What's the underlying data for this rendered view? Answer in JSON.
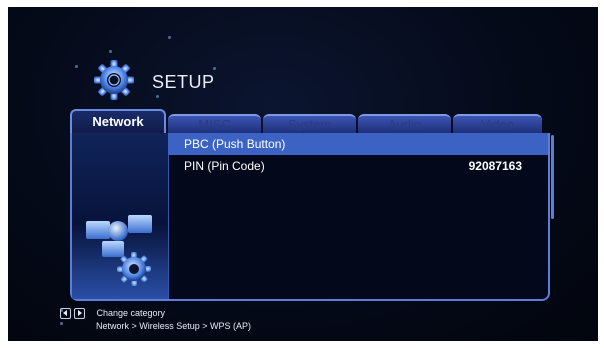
{
  "header": {
    "title": "SETUP",
    "icon": "gear-icon"
  },
  "tabs": [
    {
      "label": "Network",
      "active": true
    },
    {
      "label": "MISC",
      "active": false
    },
    {
      "label": "System",
      "active": false
    },
    {
      "label": "Audio",
      "active": false
    },
    {
      "label": "Video",
      "active": false
    }
  ],
  "options": [
    {
      "label": "PBC (Push Button)",
      "value": "",
      "selected": true
    },
    {
      "label": "PIN (Pin Code)",
      "value": "92087163",
      "selected": false
    }
  ],
  "footer": {
    "hint": "Change category",
    "breadcrumb": "Network > Wireless Setup > WPS (AP)"
  },
  "colors": {
    "accent": "#3c63c4",
    "border": "#5c7ed8",
    "background": "#050a19"
  }
}
